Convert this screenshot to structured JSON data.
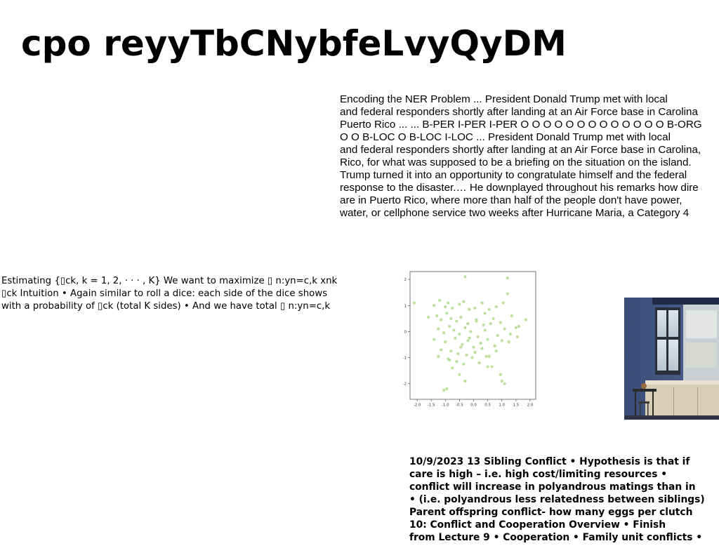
{
  "title": "cpo reyyTbCNybfeLvyQyDM",
  "ner_text": {
    "lines": [
      "Encoding the NER Problem ... President Donald Trump met with local",
      "and federal responders shortly after landing at an Air Force base in Carolina",
      "Puerto Rico ... ... B-PER I-PER I-PER O O O O O O O O O O O O O B-ORG",
      "O O B-LOC O B-LOC I-LOC ... President Donald Trump met with local",
      "and federal responders shortly after landing at an Air Force base in Carolina,",
      "Rico, for what was supposed to be a briefing on the situation on the island.",
      "Trump turned it into an opportunity to congratulate himself and the federal",
      "response to the disaster.… He downplayed throughout his remarks how dire",
      "are in Puerto Rico, where more than half of the people don't have power,",
      "water, or cellphone service two weeks after Hurricane Maria, a Category 4"
    ]
  },
  "estimating_text": {
    "lines": [
      "Estimating {▯ck, k = 1, 2, · · · , K} We want to maximize ▯ n:yn=c,k xnk",
      "▯ck Intuition • Again similar to roll a dice: each side of the dice shows",
      "with a probability of ▯ck (total K sides) • And we have total ▯ n:yn=c,k"
    ]
  },
  "sibling_text": {
    "lines": [
      "10/9/2023 13 Sibling Conflict • Hypothesis is that if",
      "care is high – i.e. high cost/limiting resources •",
      "conflict will increase in polyandrous matings than in",
      "• (i.e. polyandrous less relatedness between siblings)",
      "Parent offspring conflict- how many eggs per clutch",
      "10: Conflict and Cooperation Overview • Finish",
      "from Lecture 9 • Cooperation • Family unit conflicts •"
    ]
  },
  "chart_data": {
    "type": "scatter",
    "title": "",
    "xlabel": "",
    "ylabel": "",
    "xlim": [
      -2.25,
      2.2
    ],
    "ylim": [
      -2.6,
      2.3
    ],
    "xticks": [
      "-2.0",
      "-1.5",
      "-1.0",
      "-0.5",
      "0.0",
      "0.5",
      "1.0",
      "1.5",
      "2.0"
    ],
    "yticks": [
      "2",
      "1",
      "0",
      "-1",
      "-2"
    ],
    "grid": false,
    "point_color": "#b5dc90",
    "x": [
      -0.3,
      1.2,
      -2.1,
      -1.4,
      -1.2,
      -1.0,
      -0.9,
      -0.75,
      -0.5,
      -0.35,
      -0.15,
      0.05,
      0.3,
      0.55,
      0.8,
      1.05,
      1.2,
      -1.6,
      -1.3,
      -1.15,
      -0.95,
      -0.8,
      -0.6,
      -0.45,
      -0.2,
      0.1,
      0.35,
      0.7,
      0.95,
      1.35,
      1.6,
      1.85,
      -1.25,
      -1.05,
      -0.85,
      -0.7,
      -0.5,
      -0.3,
      -0.1,
      0.15,
      0.4,
      0.6,
      0.85,
      1.1,
      1.5,
      -1.4,
      -1.0,
      -0.65,
      -0.4,
      -0.2,
      0.0,
      0.25,
      0.5,
      0.75,
      1.0,
      1.3,
      -1.15,
      -0.8,
      -0.55,
      -0.25,
      0.05,
      0.3,
      0.55,
      0.8,
      1.25,
      1.55,
      -0.9,
      -0.6,
      -0.35,
      -0.05,
      0.2,
      0.45,
      0.65,
      -0.75,
      -0.45,
      -0.15,
      0.1,
      0.4,
      -1.25,
      -0.85,
      -0.5,
      0.5,
      0.95,
      -0.3,
      1.1,
      -1.05,
      -0.95,
      1.0
    ],
    "y": [
      2.1,
      2.05,
      1.1,
      1.0,
      1.2,
      0.95,
      1.1,
      0.9,
      1.05,
      1.15,
      0.85,
      0.9,
      1.1,
      0.85,
      0.95,
      1.1,
      1.45,
      0.55,
      0.6,
      0.45,
      0.7,
      0.5,
      0.4,
      0.55,
      0.3,
      0.45,
      0.25,
      0.5,
      0.35,
      0.6,
      0.2,
      0.45,
      0.1,
      -0.05,
      0.2,
      0.05,
      -0.1,
      0.15,
      0.0,
      -0.2,
      0.05,
      0.3,
      -0.15,
      0.1,
      0.15,
      -0.3,
      -0.4,
      -0.25,
      -0.5,
      -0.35,
      -0.6,
      -0.45,
      -0.3,
      -0.55,
      -0.35,
      -0.1,
      -0.7,
      -0.75,
      -0.85,
      -0.9,
      -0.8,
      -0.65,
      -0.95,
      -0.75,
      -0.4,
      -0.2,
      -1.05,
      -1.15,
      -1.25,
      -1.0,
      -1.2,
      -0.95,
      -1.35,
      -1.4,
      -0.6,
      -0.25,
      0.4,
      0.7,
      -0.95,
      -1.1,
      -1.65,
      -1.35,
      -1.65,
      -1.9,
      -2.0,
      -2.25,
      -2.2,
      -1.9
    ]
  }
}
